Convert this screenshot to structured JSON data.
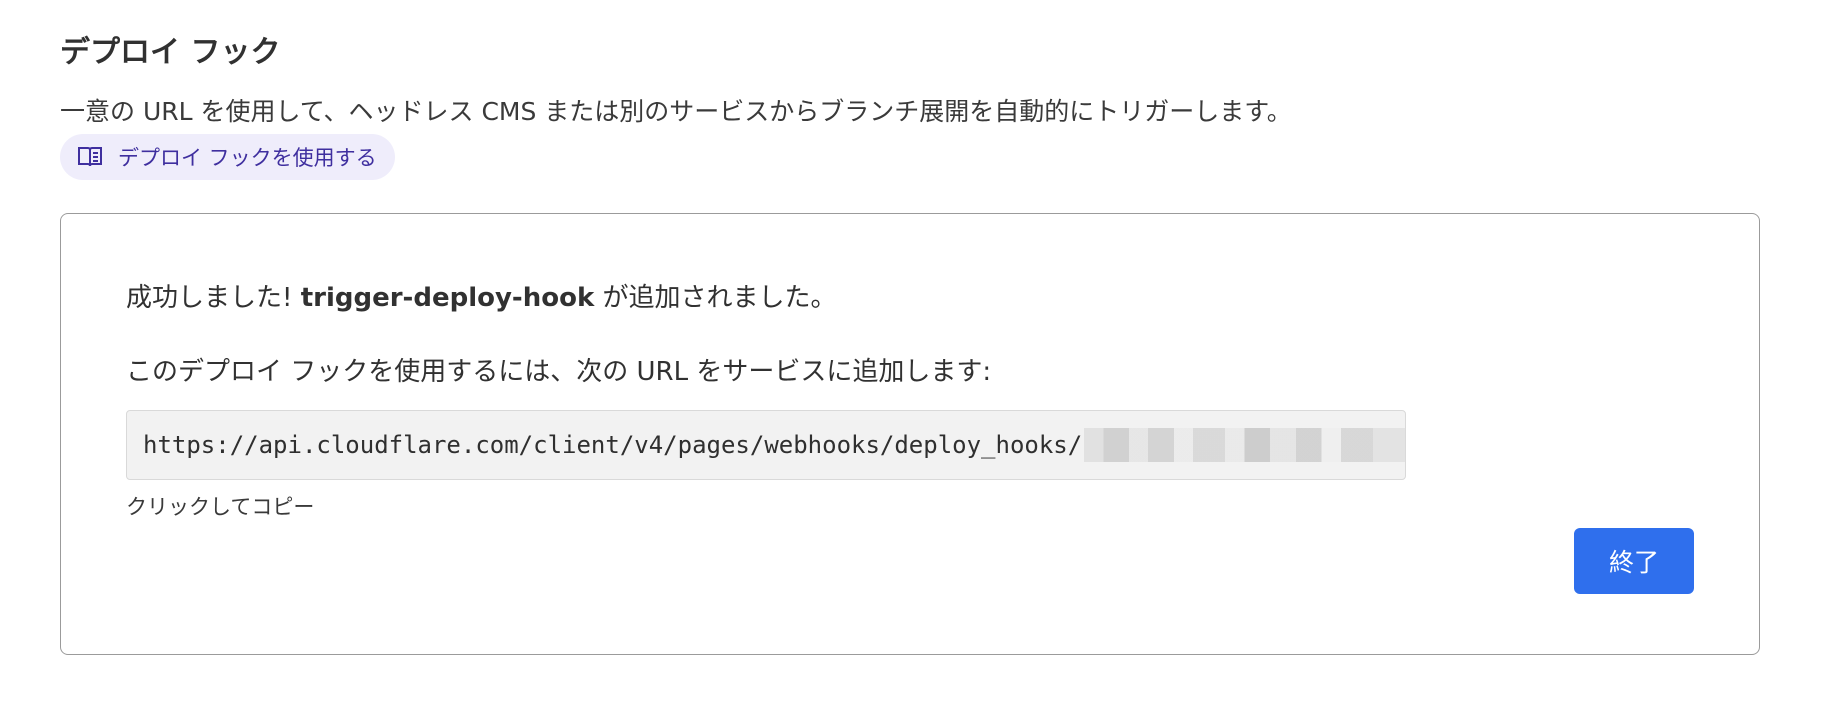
{
  "section": {
    "title": "デプロイ フック",
    "description": "一意の URL を使用して、ヘッドレス CMS または別のサービスからブランチ展開を自動的にトリガーします。",
    "doc_link": {
      "label": "デプロイ フックを使用する",
      "icon": "book-icon"
    }
  },
  "card": {
    "success_prefix": "成功しました!",
    "hook_name": "trigger-deploy-hook",
    "success_suffix": "が追加されました。",
    "instruction": "このデプロイ フックを使用するには、次の URL をサービスに追加します:",
    "url_visible": "https://api.cloudflare.com/client/v4/pages/webhooks/deploy_hooks/",
    "copy_hint": "クリックしてコピー",
    "done_label": "終了"
  },
  "colors": {
    "primary_button": "#2f6fed",
    "link_pill_bg": "#efedfb",
    "link_text": "#3f2f9f"
  }
}
